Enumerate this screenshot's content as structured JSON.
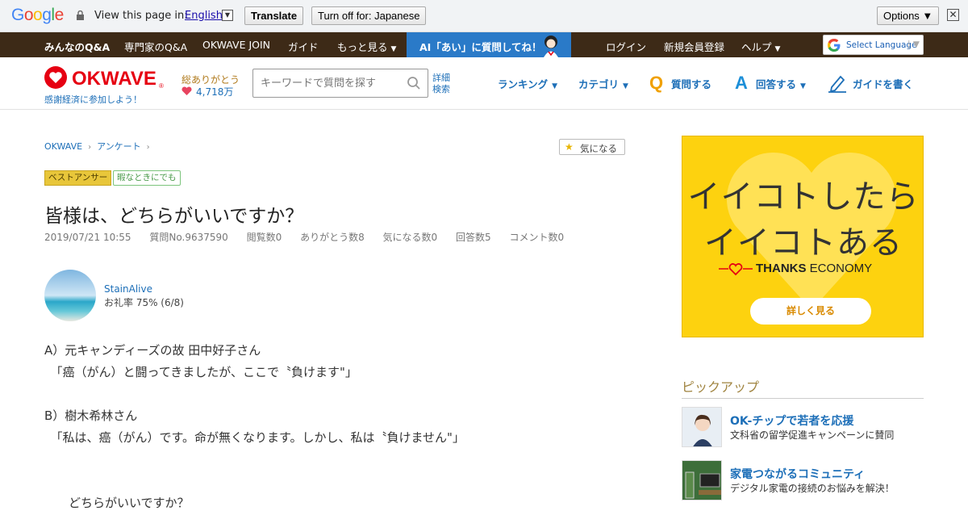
{
  "translate_bar": {
    "logo": "Google",
    "view_text": "View this page in:",
    "language": "English",
    "translate_btn": "Translate",
    "turnoff_btn": "Turn off for: Japanese",
    "options_btn": "Options ▼",
    "close": "✕"
  },
  "top_nav": {
    "items": [
      "みんなのQ&A",
      "専門家のQ&A",
      "OKWAVE JOIN",
      "ガイド",
      "もっと見る"
    ],
    "ai_banner": "AI「あい」に質問してね！",
    "right_items": [
      "ログイン",
      "新規会員登録",
      "ヘルプ"
    ],
    "select_language": "Select Language"
  },
  "header": {
    "logo_text": "OKWAVE",
    "tagline": "感謝経済に参加しよう！",
    "thanks_title": "総ありがとう",
    "thanks_count": "4,718万",
    "search_placeholder": "キーワードで質問を探す",
    "advanced_search_1": "詳細",
    "advanced_search_2": "検索",
    "nav": {
      "ranking": "ランキング",
      "category": "カテゴリ",
      "ask": "質問する",
      "answer": "回答する",
      "guide": "ガイドを書く"
    }
  },
  "breadcrumb": [
    "OKWAVE",
    "アンケート"
  ],
  "kininaru": "気になる",
  "tags": {
    "best": "ベストアンサー",
    "category": "暇なときにでも"
  },
  "question": {
    "title": "皆様は、どちらがいいですか？",
    "meta": [
      "2019/07/21 10:55",
      "質問No.9637590",
      "閲覧数0",
      "ありがとう数8",
      "気になる数0",
      "回答数5",
      "コメント数0"
    ],
    "user_name": "StainAlive",
    "user_rate": "お礼率 75%   (6/8)",
    "body": [
      "A）元キャンディーズの故 田中好子さん",
      "　「癌（がん）と闘ってきましたが、ここで〝負けます\"」",
      "B）樹木希林さん",
      "　「私は、癌（がん）です。命が無くなります。しかし、私は〝負けません\"」",
      "　　どちらがいいですか？"
    ]
  },
  "ad": {
    "line1": "イイコトしたら",
    "line2": "イイコトある",
    "brand_bold": "THANKS",
    "brand_rest": " ECONOMY",
    "button": "詳しく見る"
  },
  "pickup": {
    "title": "ピックアップ",
    "items": [
      {
        "title": "OK-チップで若者を応援",
        "desc": "文科省の留学促進キャンペーンに賛同"
      },
      {
        "title": "家電つながるコミュニティ",
        "desc": "デジタル家電の接続のお悩みを解決！"
      }
    ]
  },
  "colors": {
    "dark_nav": "#3d2a17",
    "ai_banner": "#2a7ac8",
    "link_blue": "#1d6fb8",
    "ad_yellow": "#fdd20f",
    "logo_red": "#e60012"
  }
}
